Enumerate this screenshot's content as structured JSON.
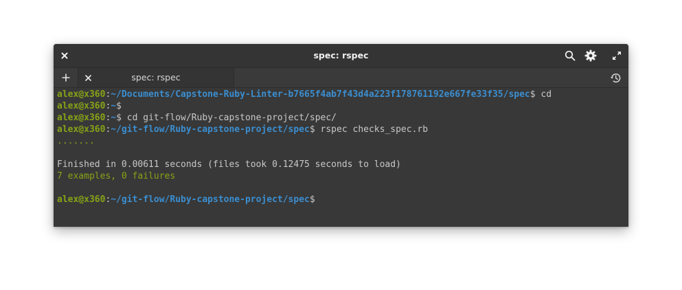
{
  "window": {
    "title": "spec: rspec"
  },
  "titlebar": {
    "close_icon": "close-icon",
    "search_icon": "search-icon",
    "settings_icon": "gear-icon",
    "fullscreen_icon": "expand-icon"
  },
  "tabs": {
    "add_icon": "plus-icon",
    "items": [
      {
        "label": "spec: rspec",
        "close_icon": "close-icon"
      }
    ],
    "history_icon": "history-icon"
  },
  "terminal": {
    "lines": [
      {
        "user": "alex@x360",
        "sep": ":",
        "path": "~/Documents/Capstone-Ruby-Linter-b7665f4ab7f43d4a223f178761192e667fe33f35/spec",
        "prompt": "$",
        "cmd": " cd"
      },
      {
        "user": "alex@x360",
        "sep": ":",
        "path": "~",
        "prompt": "$",
        "cmd": ""
      },
      {
        "user": "alex@x360",
        "sep": ":",
        "path": "~",
        "prompt": "$",
        "cmd": " cd git-flow/Ruby-capstone-project/spec/"
      },
      {
        "user": "alex@x360",
        "sep": ":",
        "path": "~/git-flow/Ruby-capstone-project/spec",
        "prompt": "$",
        "cmd": " rspec checks_spec.rb"
      }
    ],
    "progress_dots": ".......",
    "finished_text": "Finished in 0.00611 seconds (files took 0.12475 seconds to load)",
    "summary_text": "7 examples, 0 failures",
    "final_prompt": {
      "user": "alex@x360",
      "sep": ":",
      "path": "~/git-flow/Ruby-capstone-project/spec",
      "prompt": "$"
    }
  },
  "colors": {
    "user": "#87a317",
    "path": "#3b8ed0",
    "text": "#c8c8c8",
    "background": "#383838"
  }
}
